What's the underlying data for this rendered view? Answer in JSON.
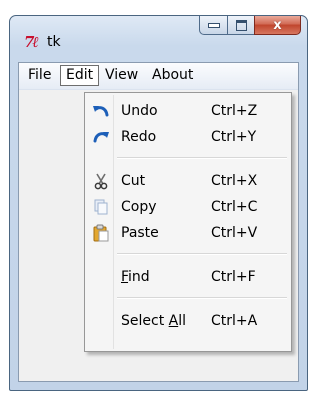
{
  "window": {
    "title": "tk",
    "app_icon": "tk-feather-icon"
  },
  "menubar": {
    "items": [
      {
        "label": "File"
      },
      {
        "label": "Edit",
        "active": true
      },
      {
        "label": "View"
      },
      {
        "label": "About"
      }
    ]
  },
  "edit_menu": {
    "items": [
      {
        "label": "Undo",
        "accel": "Ctrl+Z",
        "icon": "undo-arrow-icon"
      },
      {
        "label": "Redo",
        "accel": "Ctrl+Y",
        "icon": "redo-arrow-icon"
      },
      {
        "label": "Cut",
        "accel": "Ctrl+X",
        "icon": "scissors-icon"
      },
      {
        "label": "Copy",
        "accel": "Ctrl+C",
        "icon": "copy-icon"
      },
      {
        "label": "Paste",
        "accel": "Ctrl+V",
        "icon": "paste-icon"
      },
      {
        "label_prefix": "",
        "label_underlined": "F",
        "label_suffix": "ind",
        "accel": "Ctrl+F"
      },
      {
        "label_prefix": "Select ",
        "label_underlined": "A",
        "label_suffix": "ll",
        "accel": "Ctrl+A"
      }
    ]
  },
  "window_controls": {
    "minimize_icon": "minimize-icon",
    "maximize_icon": "maximize-icon",
    "close_icon": "close-icon",
    "close_glyph": "x"
  }
}
